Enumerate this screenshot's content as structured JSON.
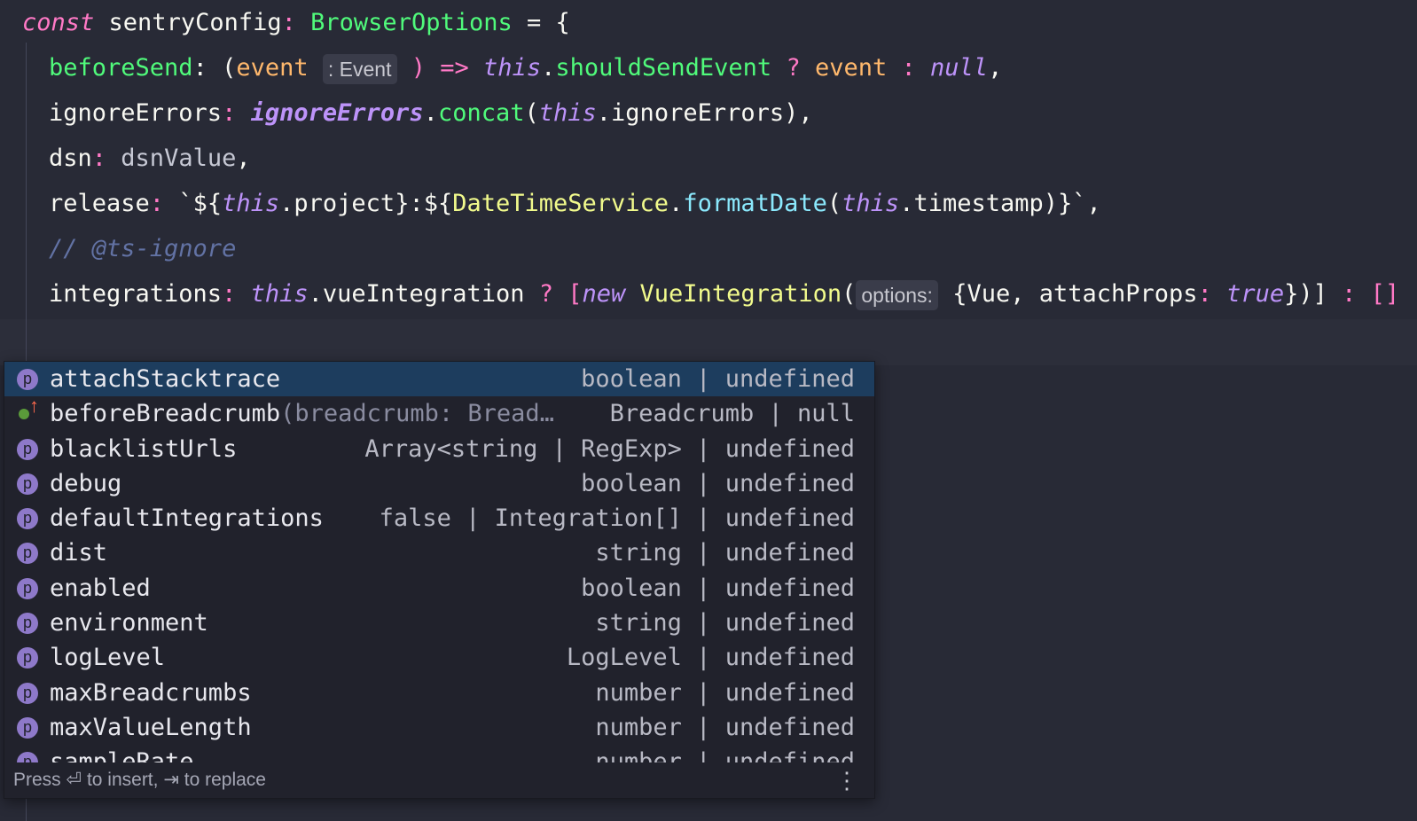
{
  "code": {
    "line1": {
      "const": "const",
      "name": "sentryConfig",
      "colon": ":",
      "type": "BrowserOptions",
      "rest": " = {"
    },
    "line2": {
      "key": "beforeSend",
      "colon": ": (",
      "param": "event",
      "hint": ": Event",
      "rest1": " ) => ",
      "this": "this",
      "dot": ".",
      "member": "shouldSendEvent",
      "q": " ? ",
      "ev": "event",
      "c": " : ",
      "nul": "null",
      "end": ","
    },
    "line3": {
      "key": "ignoreErrors",
      "colon": ": ",
      "ref": "ignoreErrors",
      "dot": ".",
      "fn": "concat",
      "open": "(",
      "this": "this",
      "dot2": ".",
      "member": "ignoreErrors",
      "end": "),"
    },
    "line4": {
      "key": "dsn",
      "colon": ": ",
      "val": "dsnValue",
      "end": ","
    },
    "line5": {
      "key": "release",
      "colon": ": ",
      "tick": "`${",
      "this": "this",
      "dot": ".",
      "member": "project",
      "mid": "}:${",
      "svc": "DateTimeService",
      "dot2": ".",
      "fn": "formatDate",
      "open": "(",
      "this2": "this",
      "dot3": ".",
      "member2": "timestamp",
      "close": ")}`",
      "end": ","
    },
    "line6": {
      "comment": "// @ts-ignore"
    },
    "line7": {
      "key": "integrations",
      "colon": ": ",
      "this": "this",
      "dot": ".",
      "member": "vueIntegration",
      "q": " ? [",
      "new": "new",
      "cls": " VueIntegration",
      "open": "(",
      "hint": "options:",
      "obj": " {Vue, attachProps",
      "c2": ": ",
      "tru": "true",
      "close": "})]",
      "tail": " : []"
    }
  },
  "suggestions": {
    "items": [
      {
        "label": "attachStacktrace",
        "sig": "",
        "type": "boolean | undefined",
        "kind": "property",
        "icon": "p"
      },
      {
        "label": "beforeBreadcrumb",
        "sig": "(breadcrumb: Bread…",
        "type": "Breadcrumb | null",
        "kind": "method",
        "icon": ""
      },
      {
        "label": "blacklistUrls",
        "sig": "",
        "type": "Array<string | RegExp> | undefined",
        "kind": "property",
        "icon": "p"
      },
      {
        "label": "debug",
        "sig": "",
        "type": "boolean | undefined",
        "kind": "property",
        "icon": "p"
      },
      {
        "label": "defaultIntegrations",
        "sig": "",
        "type": "false | Integration[] | undefined",
        "kind": "property",
        "icon": "p"
      },
      {
        "label": "dist",
        "sig": "",
        "type": "string | undefined",
        "kind": "property",
        "icon": "p"
      },
      {
        "label": "enabled",
        "sig": "",
        "type": "boolean | undefined",
        "kind": "property",
        "icon": "p"
      },
      {
        "label": "environment",
        "sig": "",
        "type": "string | undefined",
        "kind": "property",
        "icon": "p"
      },
      {
        "label": "logLevel",
        "sig": "",
        "type": "LogLevel | undefined",
        "kind": "property",
        "icon": "p"
      },
      {
        "label": "maxBreadcrumbs",
        "sig": "",
        "type": "number | undefined",
        "kind": "property",
        "icon": "p"
      },
      {
        "label": "maxValueLength",
        "sig": "",
        "type": "number | undefined",
        "kind": "property",
        "icon": "p"
      },
      {
        "label": "sampleRate",
        "sig": "",
        "type": "number | undefined",
        "kind": "property",
        "icon": "p"
      }
    ],
    "selected_index": 0,
    "footer": "Press ⏎ to insert, ⇥ to replace",
    "more_icon": "⋮"
  }
}
